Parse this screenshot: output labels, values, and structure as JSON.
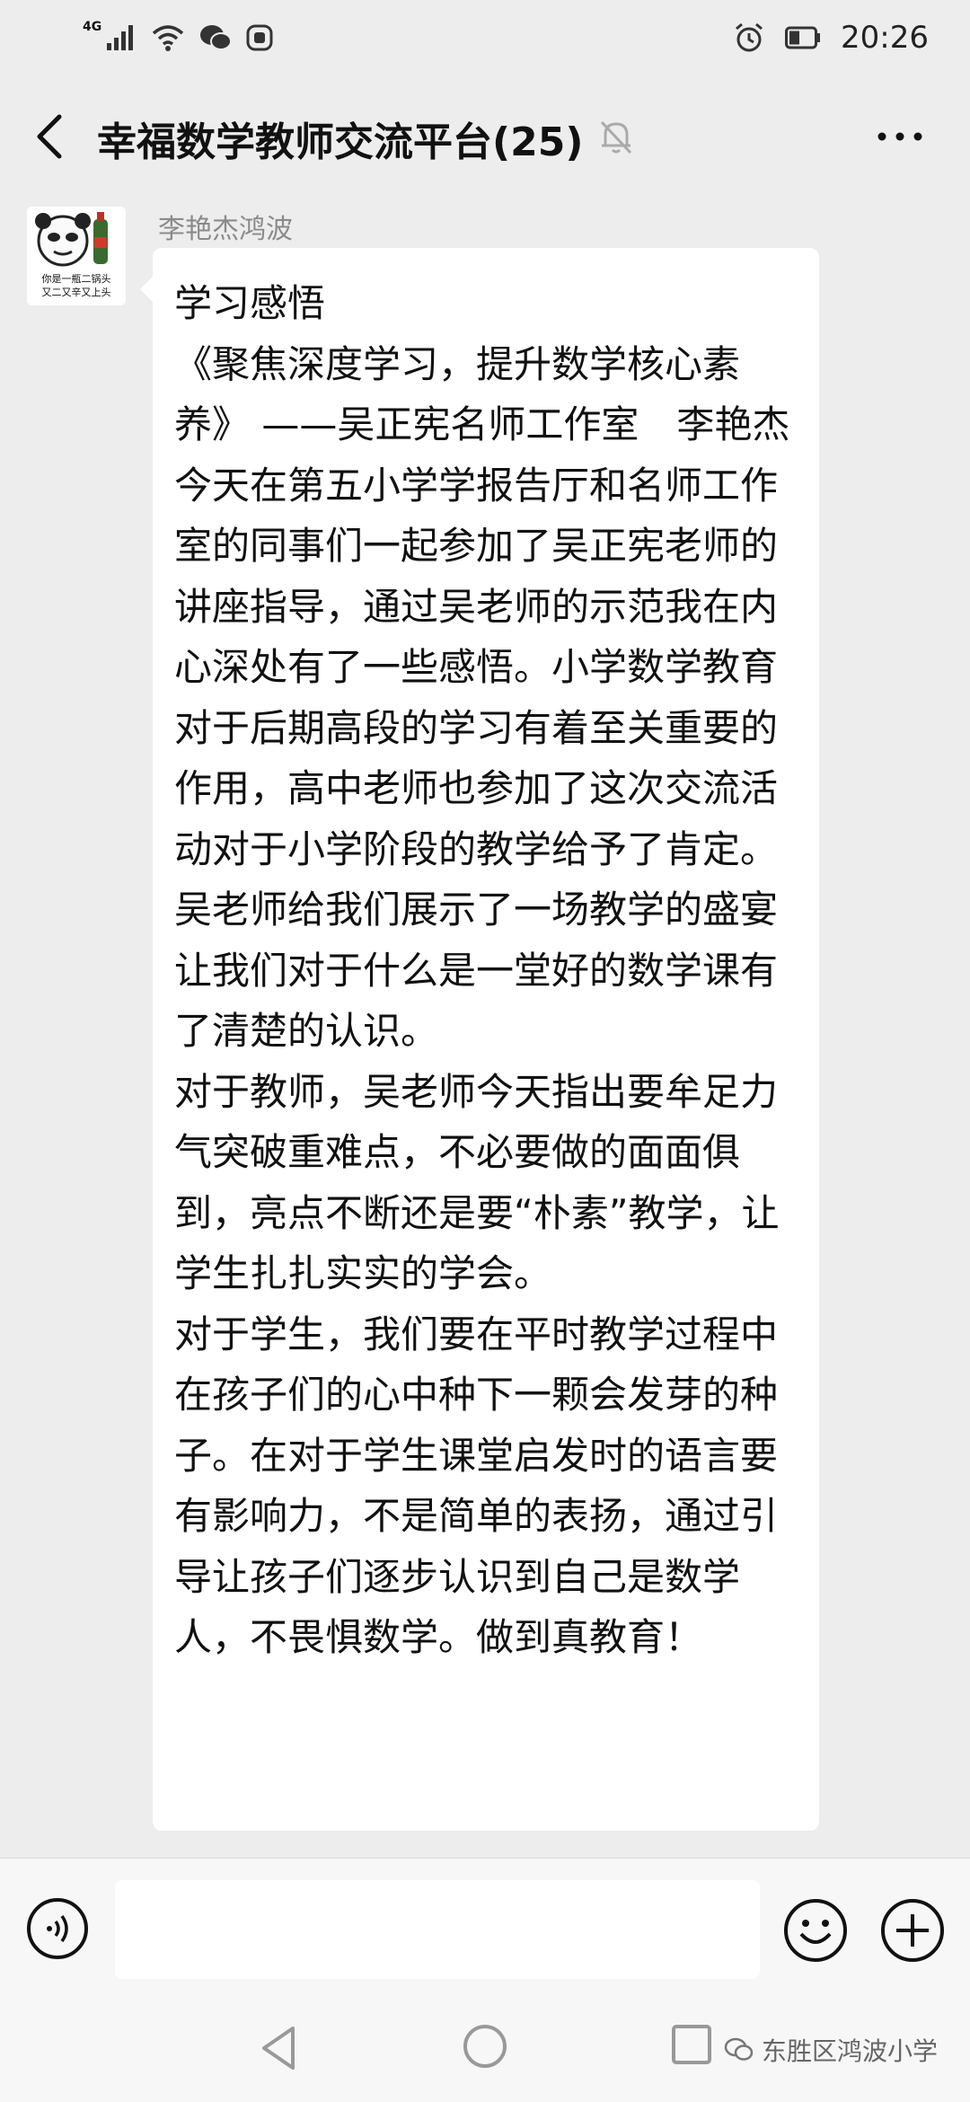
{
  "status_bar": {
    "network": "4G",
    "time": "20:26"
  },
  "header": {
    "title": "幸福数学教师交流平台(25)"
  },
  "message": {
    "sender": "李艳杰鸿波",
    "avatar_caption_line1": "你是一瓶二锅头",
    "avatar_caption_line2": "又二又辛又上头",
    "paragraphs": [
      "学习感悟",
      "《聚焦深度学习，提升数学核心素养》 ——吴正宪名师工作室　李艳杰",
      "今天在第五小学学报告厅和名师工作室的同事们一起参加了吴正宪老师的讲座指导，通过吴老师的示范我在内心深处有了一些感悟。小学数学教育对于后期高段的学习有着至关重要的作用，高中老师也参加了这次交流活动对于小学阶段的教学给予了肯定。",
      "吴老师给我们展示了一场教学的盛宴让我们对于什么是一堂好的数学课有了清楚的认识。",
      "对于教师，吴老师今天指出要牟足力气突破重难点，不必要做的面面俱到，亮点不断还是要“朴素”教学，让学生扎扎实实的学会。",
      "对于学生，我们要在平时教学过程中在孩子们的心中种下一颗会发芽的种子。在对于学生课堂启发时的语言要有影响力，不是简单的表扬，通过引导让孩子们逐步认识到自己是数学人，不畏惧数学。做到真教育！"
    ]
  },
  "input": {
    "value": ""
  },
  "watermark": {
    "text": "东胜区鸿波小学"
  },
  "icons": {
    "status": [
      "signal-icon",
      "wifi-icon",
      "wechat-icon",
      "app-icon",
      "alarm-icon",
      "battery-icon"
    ],
    "header": [
      "back-icon",
      "mute-bell-icon",
      "more-icon"
    ],
    "input": [
      "voice-icon",
      "emoji-icon",
      "plus-icon"
    ],
    "nav": [
      "nav-back-icon",
      "nav-home-icon",
      "nav-recent-icon"
    ]
  }
}
